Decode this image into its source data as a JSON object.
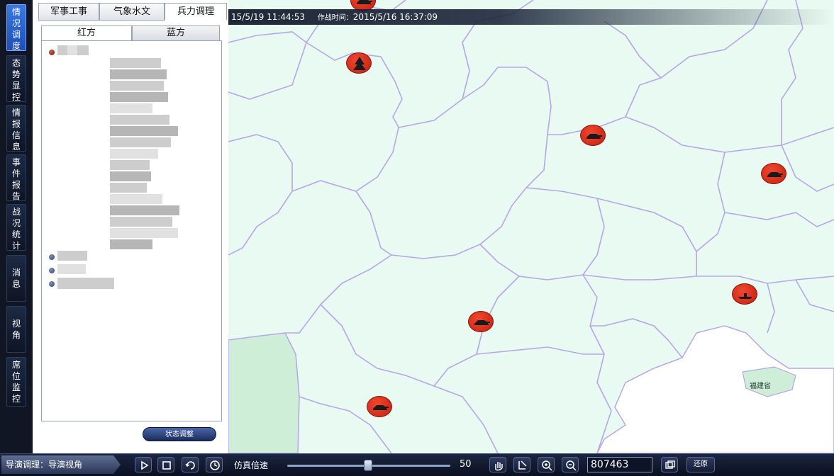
{
  "vertical_tabs": [
    {
      "label": "情况调度",
      "active": true
    },
    {
      "label": "态势显控",
      "active": false
    },
    {
      "label": "情报信息",
      "active": false
    },
    {
      "label": "事件报告",
      "active": false
    },
    {
      "label": "战况统计",
      "active": false
    },
    {
      "label": "消息",
      "active": false
    },
    {
      "label": "视角",
      "active": false
    },
    {
      "label": "席位监控",
      "active": false
    }
  ],
  "panel": {
    "top_tabs": [
      {
        "label": "军事工事",
        "active": false
      },
      {
        "label": "气象水文",
        "active": false
      },
      {
        "label": "兵力调理",
        "active": true
      }
    ],
    "sub_tabs": [
      {
        "label": "红方",
        "active": true
      },
      {
        "label": "蓝方",
        "active": false
      }
    ],
    "status_button": "状态调整"
  },
  "map": {
    "time_current": "15/5/19 11:44:53",
    "time_label": "作战时间：",
    "time_value": "2015/5/16 16:37:09",
    "province_label": "福建省",
    "marker_icons": [
      "pine-tree-icon",
      "tank-icon",
      "tank-icon",
      "tank-icon",
      "ship-icon",
      "tank-icon",
      "tank-icon"
    ],
    "colors": {
      "land": "#e8faf1",
      "border": "#b7a6e8",
      "marker": "#e3321f",
      "water": "#ffffff"
    }
  },
  "toolbar": {
    "mode_label": "导演调理：导演视角",
    "speed_label": "仿真倍速",
    "speed_value": "50",
    "zoom_value": "807463",
    "last_button": "还原"
  }
}
